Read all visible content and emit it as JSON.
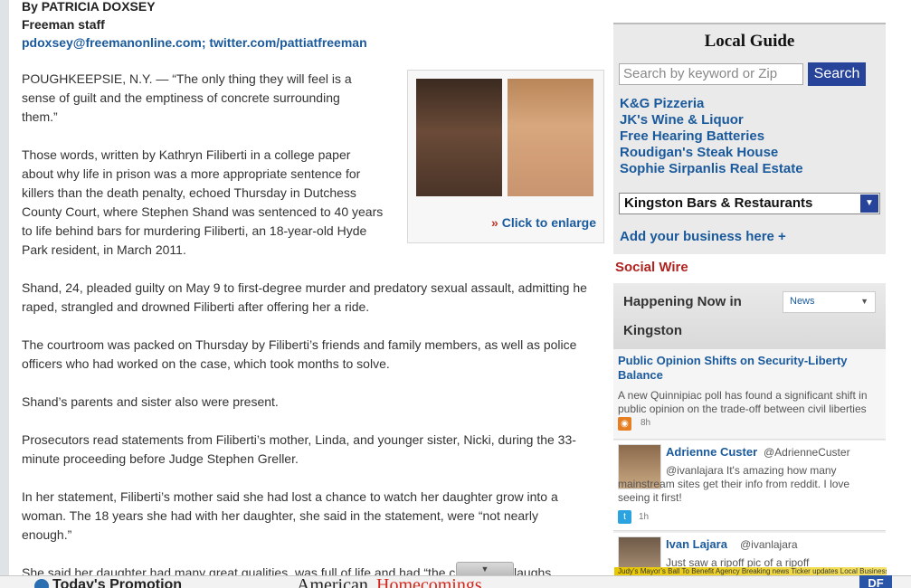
{
  "byline": {
    "author": "By PATRICIA DOXSEY",
    "staff": "Freeman staff",
    "contact": "pdoxsey@freemanonline.com; twitter.com/pattiatfreeman"
  },
  "article": {
    "paragraphs": [
      "POUGHKEEPSIE, N.Y. — “The only thing they will feel is a sense of guilt and the emptiness of concrete surrounding them.”",
      "Those words, written by Kathryn Filiberti in a college paper about why life in prison was a more appropriate sentence for killers than the death penalty, echoed Thursday in Dutchess County Court, where Stephen Shand was sentenced to 40 years to life behind bars for murdering Filiberti, an 18-year-old Hyde Park resident, in March 2011.",
      "Shand, 24, pleaded guilty on May 9 to first-degree murder and predatory sexual assault, admitting he raped, strangled and drowned Filiberti after offering her a ride.",
      "The courtroom was packed on Thursday by Filiberti’s friends and family members, as well as police officers who had worked on the case, which took months to solve.",
      "Shand’s parents and sister also were present.",
      "Prosecutors read statements from Filiberti’s mother, Linda, and younger sister, Nicki, during the 33-minute proceeding before Judge Stephen Greller.",
      "In her statement, Filiberti’s mother said she had lost a chance to watch her daughter grow into a woman. The 18 years she had with her daughter,  she said in the statement, were “not nearly enough.”",
      "She said her daughter had many great qualities, was full of life and had “the contagious laughs"
    ],
    "enlarge_label": "Click to enlarge"
  },
  "local_guide": {
    "title": "Local Guide",
    "search_placeholder": "Search by keyword or Zip",
    "search_button": "Search",
    "businesses": [
      "K&G Pizzeria",
      "JK's Wine & Liquor",
      "Free Hearing Batteries",
      "Roudigan's Steak House",
      "Sophie Sirpanlis Real Estate"
    ],
    "category_select": "Kingston Bars & Restaurants",
    "add_business": "Add your business here +"
  },
  "social_wire": {
    "title": "Social Wire",
    "heading_line1": "Happening Now in",
    "heading_line2": "Kingston",
    "filter_value": "News",
    "items": [
      {
        "title": "Public Opinion Shifts on Security-Liberty Balance",
        "desc": "A new Quinnipiac poll has found a significant shift in public opinion on the trade-off between civil liberties",
        "age": "8h"
      },
      {
        "name": "Adrienne Custer",
        "handle": "@AdrienneCuster",
        "text": "@ivanlajara It's amazing how many mainstream sites get their info from reddit. I love seeing it first!",
        "age": "1h"
      },
      {
        "name": "Ivan Lajara",
        "handle": "@ivanlajara",
        "text": "Just saw a ripoff pic of a ripoff"
      }
    ]
  },
  "bottom_bar": {
    "promo": "Today's Promotion",
    "homecomings_1": "American",
    "homecomings_2": "Homecomings",
    "ticker": "Judy’s Mayor’s Ball To Benefit Agency Breaking news Ticker updates Local Businesses Today",
    "df_badge": "DF"
  },
  "colors": {
    "link": "#1a5a9c",
    "accent_red": "#b0231f",
    "button_blue": "#27449a"
  }
}
